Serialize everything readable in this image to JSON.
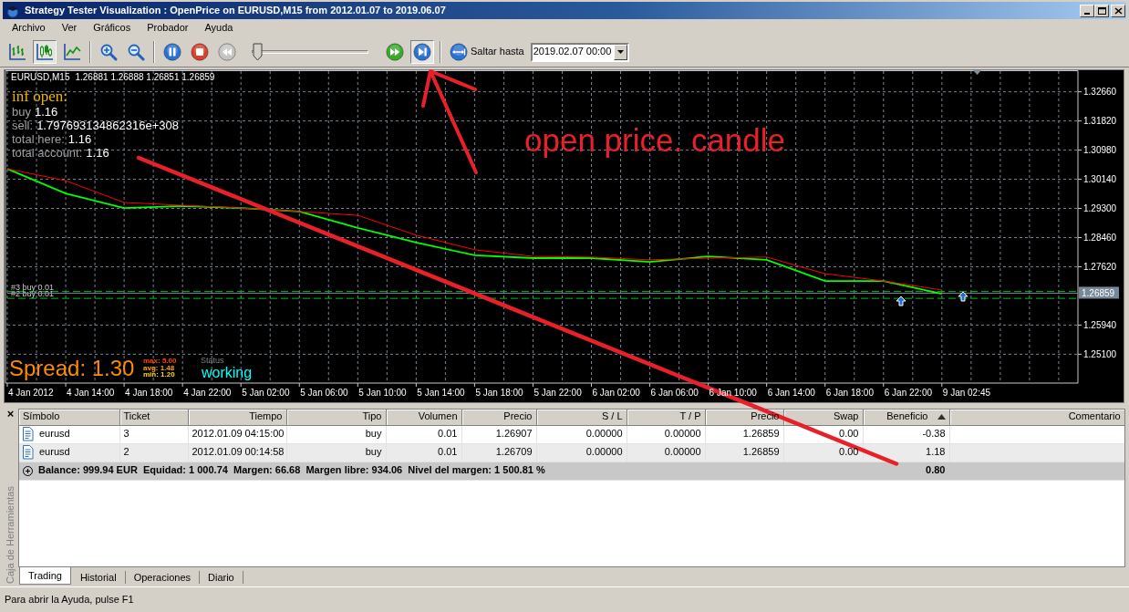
{
  "window": {
    "title": "Strategy Tester Visualization : OpenPrice on EURUSD,M15 from 2012.01.07 to 2019.06.07"
  },
  "menu": [
    "Archivo",
    "Ver",
    "Gráficos",
    "Probador",
    "Ayuda"
  ],
  "toolbar": {
    "chart_modes": [
      {
        "kind": "bars",
        "selected": false
      },
      {
        "kind": "candles",
        "selected": true
      },
      {
        "kind": "line",
        "selected": false
      }
    ],
    "zoom": [
      {
        "kind": "zoom_in"
      },
      {
        "kind": "zoom_out"
      }
    ],
    "playback": [
      {
        "kind": "pause",
        "disabled": false,
        "on": false
      },
      {
        "kind": "stop",
        "disabled": false,
        "on": false
      },
      {
        "kind": "rewind",
        "disabled": true,
        "on": false
      },
      {
        "kind": "slider",
        "level": 0
      },
      {
        "kind": "fast_forward",
        "disabled": false,
        "on": false
      },
      {
        "kind": "step",
        "disabled": false,
        "on": true
      }
    ],
    "jump": {
      "label": "Saltar hasta",
      "value": "2019.02.07 00:00"
    }
  },
  "chart": {
    "symbol": "EURUSD,M15",
    "quotes": "1.26881 1.26888 1.26851 1.26859",
    "info": {
      "title": "inf open:",
      "lines": [
        {
          "label": "buy",
          "value": "1.16"
        },
        {
          "label": "sell:",
          "value": "1.797693134862316e+308"
        },
        {
          "label": "total here:",
          "value": "1.16"
        },
        {
          "label": "total account:",
          "value": "1.16"
        }
      ]
    },
    "spread": {
      "text": "Spread: 1.30",
      "stats": [
        {
          "text": "max: 5.00",
          "color": "#ff4500"
        },
        {
          "text": "avg: 1.48",
          "color": "#ffa500"
        },
        {
          "text": "min: 1.20",
          "color": "#ffd700"
        }
      ]
    },
    "status": {
      "label": "Status",
      "value": "working"
    },
    "chart_data": {
      "type": "line",
      "categories": [
        "4 Jan 2012",
        "4 Jan 14:00",
        "4 Jan 18:00",
        "4 Jan 22:00",
        "5 Jan 02:00",
        "5 Jan 06:00",
        "5 Jan 10:00",
        "5 Jan 14:00",
        "5 Jan 18:00",
        "5 Jan 22:00",
        "6 Jan 02:00",
        "6 Jan 06:00",
        "6 Jan 10:00",
        "6 Jan 14:00",
        "6 Jan 18:00",
        "6 Jan 22:00",
        "9 Jan 02:45"
      ],
      "series": [
        {
          "color": "#00ff00",
          "values": [
            1.3044,
            1.2973,
            1.2931,
            1.2937,
            1.2931,
            1.2921,
            1.2874,
            1.2832,
            1.2795,
            1.2787,
            1.2787,
            1.2776,
            1.2792,
            1.2782,
            1.2721,
            1.2721,
            1.2684
          ]
        },
        {
          "color": "#ff0000",
          "values": [
            1.3044,
            1.301,
            1.2947,
            1.2939,
            1.2931,
            1.2921,
            1.291,
            1.2853,
            1.2811,
            1.2792,
            1.279,
            1.2782,
            1.2787,
            1.279,
            1.2742,
            1.2721,
            1.2695
          ]
        }
      ],
      "ylim": [
        1.2427,
        1.33254
      ],
      "yticks": [
        {
          "value": 1.3266,
          "label": "1.32660"
        },
        {
          "value": 1.3182,
          "label": "1.31820"
        },
        {
          "value": 1.3098,
          "label": "1.30980"
        },
        {
          "value": 1.3014,
          "label": "1.30140"
        },
        {
          "value": 1.293,
          "label": "1.29300"
        },
        {
          "value": 1.2846,
          "label": "1.28460"
        },
        {
          "value": 1.2762,
          "label": "1.27620"
        },
        {
          "value": 1.2594,
          "label": "1.25940"
        },
        {
          "value": 1.251,
          "label": "1.25100"
        }
      ],
      "grid": true,
      "ref_lines": [
        {
          "axis": "y",
          "value": 1.26907,
          "label": "#3 buy 0.01",
          "color": "#00c000"
        },
        {
          "axis": "y",
          "value": 1.26709,
          "label": "#2 buy 0.01",
          "color": "#00c000"
        },
        {
          "axis": "y",
          "value": 1.26859,
          "color": "#778899"
        }
      ],
      "annotations": [
        "1.26859"
      ]
    }
  },
  "annotation": {
    "text": "open price. candle"
  },
  "trades": {
    "columns": [
      {
        "label": "Símbolo",
        "sorted": false
      },
      {
        "label": "Ticket",
        "sorted": false
      },
      {
        "label": "Tiempo",
        "sorted": false
      },
      {
        "label": "Tipo",
        "sorted": false
      },
      {
        "label": "Volumen",
        "sorted": false
      },
      {
        "label": "Precio",
        "sorted": false
      },
      {
        "label": "S / L",
        "sorted": false
      },
      {
        "label": "T / P",
        "sorted": false
      },
      {
        "label": "Precio",
        "sorted": false
      },
      {
        "label": "Swap",
        "sorted": false
      },
      {
        "label": "Beneficio",
        "sorted": true
      },
      {
        "label": "Comentario",
        "sorted": false
      }
    ],
    "rows": [
      {
        "cells": [
          "eurusd",
          "3",
          "2012.01.09 04:15:00",
          "buy",
          "0.01",
          "1.26907",
          "0.00000",
          "0.00000",
          "1.26859",
          "0.00",
          "-0.38"
        ]
      },
      {
        "cells": [
          "eurusd",
          "2",
          "2012.01.09 00:14:58",
          "buy",
          "0.01",
          "1.26709",
          "0.00000",
          "0.00000",
          "1.26859",
          "0.00",
          "1.18"
        ]
      }
    ],
    "summary": {
      "text": "Balance: 999.94 EUR  Equidad: 1 000.74  Margen: 66.68  Margen libre: 934.06  Nivel del margen: 1 500.81 %",
      "profit": "0.80"
    }
  },
  "toolbox": {
    "close": "×",
    "title": "Caja de Herramientas"
  },
  "terminal_tabs": [
    {
      "label": "Trading",
      "selected": true
    },
    {
      "label": "Historial",
      "selected": false
    },
    {
      "label": "Operaciones",
      "selected": false
    },
    {
      "label": "Diario",
      "selected": false
    }
  ],
  "status_bar": "Para abrir la Ayuda, pulse F1"
}
